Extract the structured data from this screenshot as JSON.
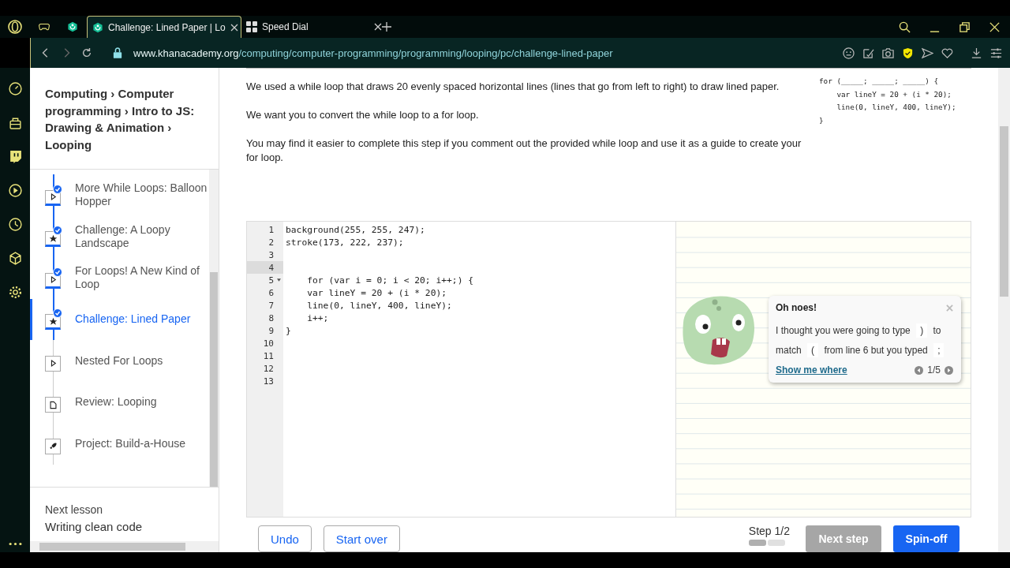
{
  "browser": {
    "tabs": [
      {
        "kind": "gamepad",
        "selected": false
      },
      {
        "kind": "khan",
        "selected": false
      },
      {
        "kind": "khan",
        "title": "Challenge: Lined Paper | Lo",
        "selected": true
      },
      {
        "kind": "grid",
        "title": "Speed Dial",
        "selected": false
      }
    ],
    "url_host": "www.khanacademy.org",
    "url_path": "/computing/computer-programming/programming/looping/pc/challenge-lined-paper"
  },
  "breadcrumb": "Computing › Computer programming › Intro to JS: Drawing & Animation › Looping",
  "lessons": [
    {
      "title": "More While Loops: Balloon Hopper",
      "kind": "video",
      "completed": true,
      "selected": false
    },
    {
      "title": "Challenge: A Loopy Landscape",
      "kind": "challenge",
      "completed": true,
      "selected": false
    },
    {
      "title": "For Loops! A New Kind of Loop",
      "kind": "video",
      "completed": true,
      "selected": false
    },
    {
      "title": "Challenge: Lined Paper",
      "kind": "challenge",
      "completed": true,
      "selected": true
    },
    {
      "title": "Nested For Loops",
      "kind": "video",
      "completed": false,
      "selected": false
    },
    {
      "title": "Review: Looping",
      "kind": "article",
      "completed": false,
      "selected": false
    },
    {
      "title": "Project: Build-a-House",
      "kind": "project",
      "completed": false,
      "selected": false
    }
  ],
  "next_lesson": {
    "label": "Next lesson",
    "title": "Writing clean code"
  },
  "instructions": [
    "We used a while loop that draws 20 evenly spaced horizontal lines (lines that go from left to right) to draw lined paper.",
    "We want you to convert the while loop to a for loop.",
    "You may find it easier to complete this step if you comment out the provided while loop and use it as a guide to create your for loop."
  ],
  "hint_code": [
    "for (_____; _____; _____) {",
    "    var lineY = 20 + (i * 20);",
    "    line(0, lineY, 400, lineY);",
    "}"
  ],
  "editor": {
    "lines": [
      {
        "number": "1",
        "code": "background(255, 255, 247);",
        "active": false
      },
      {
        "number": "2",
        "code": "stroke(173, 222, 237);",
        "active": false
      },
      {
        "number": "3",
        "active": false
      },
      {
        "number": "4",
        "active": true
      },
      {
        "number": "5",
        "code": "    for (var i = 0; i < 20; i++;) {",
        "active": false,
        "foldable": true
      },
      {
        "number": "6",
        "code": "    var lineY = 20 + (i * 20);",
        "active": false
      },
      {
        "number": "7",
        "code": "    line(0, lineY, 400, lineY);",
        "active": false
      },
      {
        "number": "8",
        "code": "    i++;",
        "active": false
      },
      {
        "number": "9",
        "code": "}",
        "active": false
      },
      {
        "number": "10",
        "active": false
      },
      {
        "number": "11",
        "active": false
      },
      {
        "number": "12",
        "active": false
      },
      {
        "number": "13",
        "active": false
      }
    ]
  },
  "error_bubble": {
    "title": "Oh noes!",
    "message": [
      {
        "kind": "text",
        "text": "I thought you were going to type"
      },
      {
        "kind": "code",
        "text": ")"
      },
      {
        "kind": "text",
        "text": "to match"
      },
      {
        "kind": "code",
        "text": "("
      },
      {
        "kind": "text",
        "text": "from line 6 but you typed"
      },
      {
        "kind": "code",
        "text": ";"
      }
    ],
    "link": "Show me where",
    "pager": "1/5"
  },
  "footer": {
    "buttons": [
      {
        "label": "Undo"
      },
      {
        "label": "Start over"
      }
    ],
    "step": "Step 1/2",
    "step_segments": [
      {
        "done": true
      },
      {
        "done": false
      }
    ],
    "next_step": {
      "label": "Next step",
      "disabled": true
    },
    "spinoff": "Spin-off"
  }
}
